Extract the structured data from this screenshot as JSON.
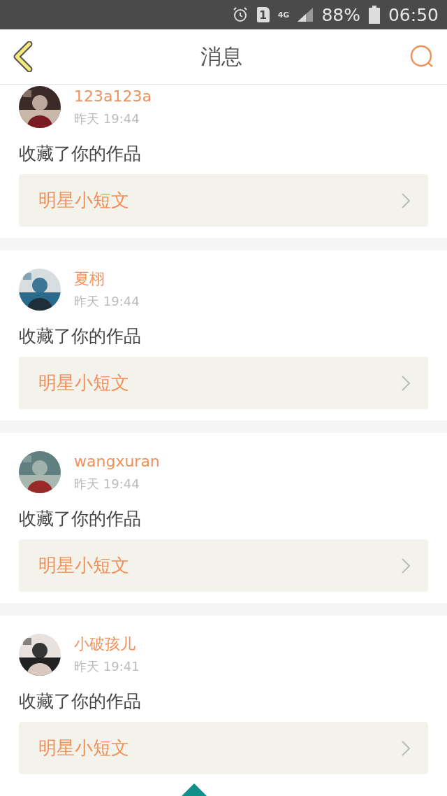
{
  "status_bar": {
    "sim": "1",
    "network": "4G",
    "battery": "88%",
    "time": "06:50"
  },
  "header": {
    "title": "消息"
  },
  "messages": [
    {
      "user": "123a123a",
      "time": "昨天 19:44",
      "action": "收藏了你的作品",
      "work": "明星小短文"
    },
    {
      "user": "夏栩",
      "time": "昨天 19:44",
      "action": "收藏了你的作品",
      "work": "明星小短文"
    },
    {
      "user": "wangxuran",
      "time": "昨天 19:44",
      "action": "收藏了你的作品",
      "work": "明星小短文"
    },
    {
      "user": "小破孩儿",
      "time": "昨天 19:41",
      "action": "收藏了你的作品",
      "work": "明星小短文"
    }
  ]
}
